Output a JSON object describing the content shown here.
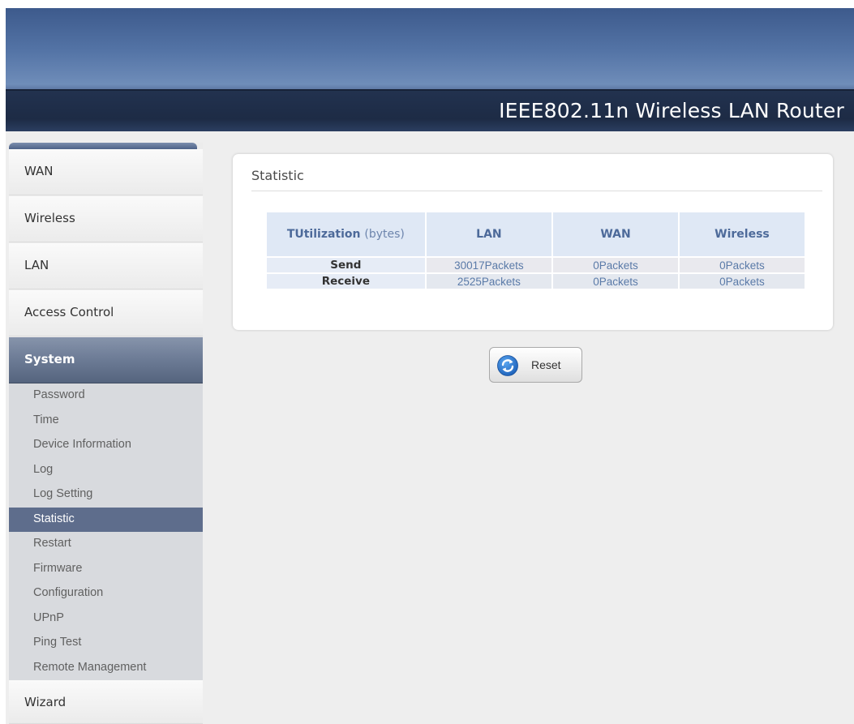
{
  "header": {
    "title": "IEEE802.11n  Wireless LAN Router"
  },
  "sidebar": {
    "menu": [
      {
        "label": "WAN"
      },
      {
        "label": "Wireless"
      },
      {
        "label": "LAN"
      },
      {
        "label": "Access Control"
      },
      {
        "label": "System",
        "active": true
      },
      {
        "label": "Wizard"
      }
    ],
    "system_submenu": [
      {
        "label": "Password"
      },
      {
        "label": "Time"
      },
      {
        "label": "Device Information"
      },
      {
        "label": "Log"
      },
      {
        "label": "Log Setting"
      },
      {
        "label": "Statistic",
        "active": true
      },
      {
        "label": "Restart"
      },
      {
        "label": "Firmware"
      },
      {
        "label": "Configuration"
      },
      {
        "label": "UPnP"
      },
      {
        "label": "Ping Test"
      },
      {
        "label": "Remote Management"
      }
    ]
  },
  "panel": {
    "title": "Statistic",
    "table": {
      "header_utilization": "TUtilization",
      "header_unit": "(bytes)",
      "columns": [
        "LAN",
        "WAN",
        "Wireless"
      ],
      "rows": [
        {
          "label": "Send",
          "values": [
            "30017Packets",
            "0Packets",
            "0Packets"
          ]
        },
        {
          "label": "Receive",
          "values": [
            "2525Packets",
            "0Packets",
            "0Packets"
          ]
        }
      ]
    }
  },
  "actions": {
    "reset_label": "Reset",
    "reset_icon": "refresh-icon"
  },
  "colors": {
    "header_dark": "#1d2b45",
    "accent_active": "#5e6d8c",
    "table_header_text": "#4d6a9a",
    "table_value_text": "#5a7aa8"
  }
}
